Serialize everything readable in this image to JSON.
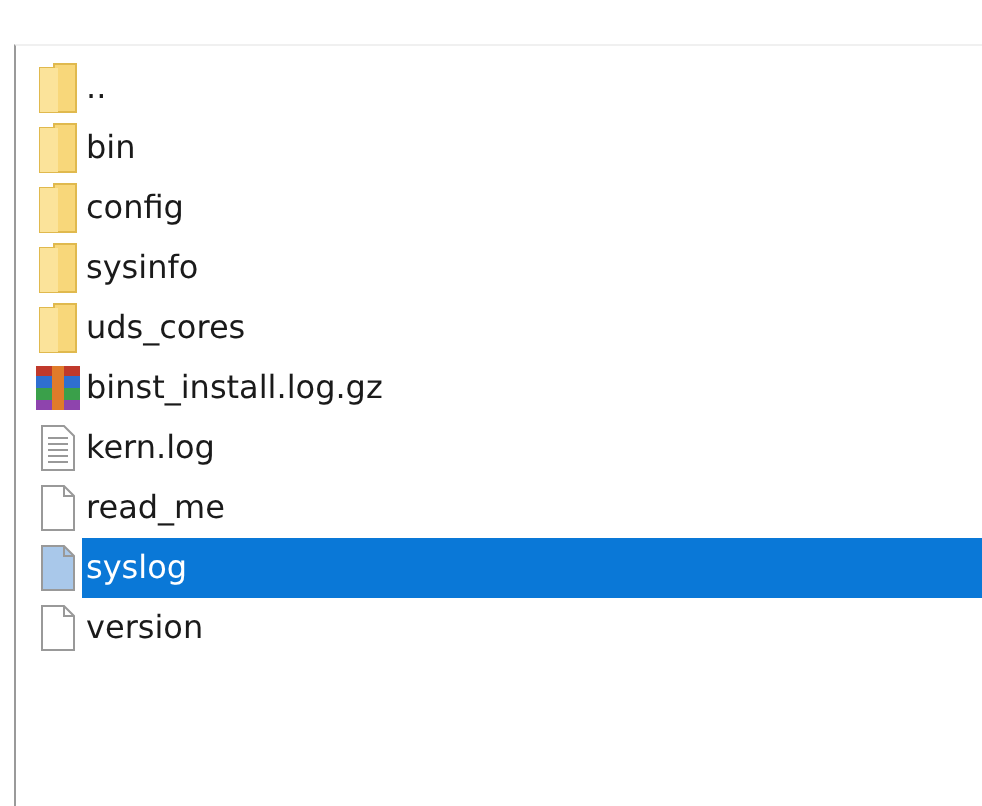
{
  "files": [
    {
      "name": "..",
      "kind": "folder",
      "selected": false
    },
    {
      "name": "bin",
      "kind": "folder",
      "selected": false
    },
    {
      "name": "config",
      "kind": "folder",
      "selected": false
    },
    {
      "name": "sysinfo",
      "kind": "folder",
      "selected": false
    },
    {
      "name": "uds_cores",
      "kind": "folder",
      "selected": false
    },
    {
      "name": "binst_install.log.gz",
      "kind": "archive",
      "selected": false
    },
    {
      "name": "kern.log",
      "kind": "text",
      "selected": false
    },
    {
      "name": "read_me",
      "kind": "file",
      "selected": false
    },
    {
      "name": "syslog",
      "kind": "file",
      "selected": true
    },
    {
      "name": "version",
      "kind": "file",
      "selected": false
    }
  ]
}
